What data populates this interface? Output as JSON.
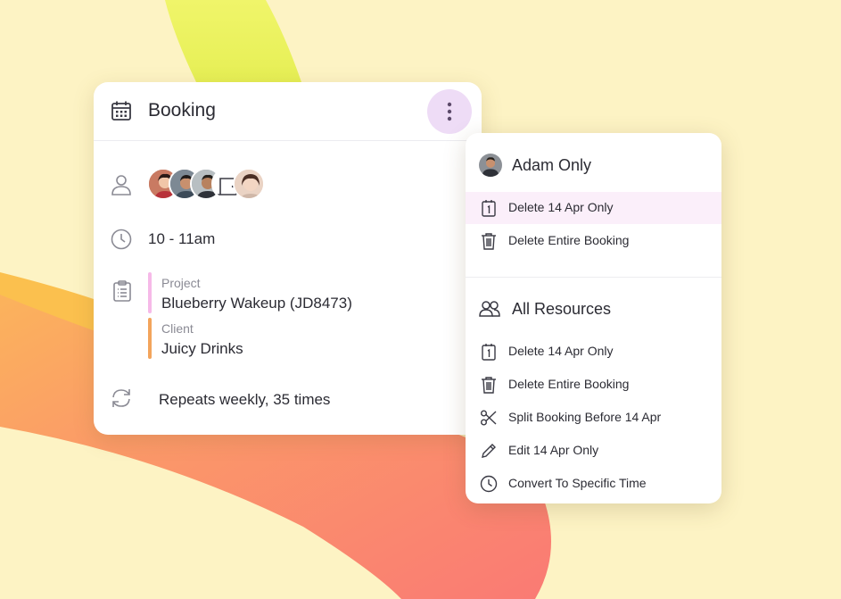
{
  "booking": {
    "title": "Booking",
    "time": "10 - 11am",
    "project_label": "Project",
    "project_value": "Blueberry Wakeup (JD8473)",
    "client_label": "Client",
    "client_value": "Juicy Drinks",
    "repeat": "Repeats weekly, 35 times"
  },
  "menu": {
    "section1": {
      "title": "Adam Only",
      "items": [
        "Delete 14 Apr Only",
        "Delete Entire Booking"
      ]
    },
    "section2": {
      "title": "All Resources",
      "items": [
        "Delete 14 Apr Only",
        "Delete Entire Booking",
        "Split Booking Before 14 Apr",
        "Edit 14 Apr Only",
        "Convert To Specific Time"
      ]
    }
  },
  "colors": {
    "background": "#fdf3c4",
    "project_bar": "#f6b9e8",
    "client_bar": "#f3a45c",
    "kebab_bg": "#eedcf6",
    "highlight": "#fbeffa"
  }
}
